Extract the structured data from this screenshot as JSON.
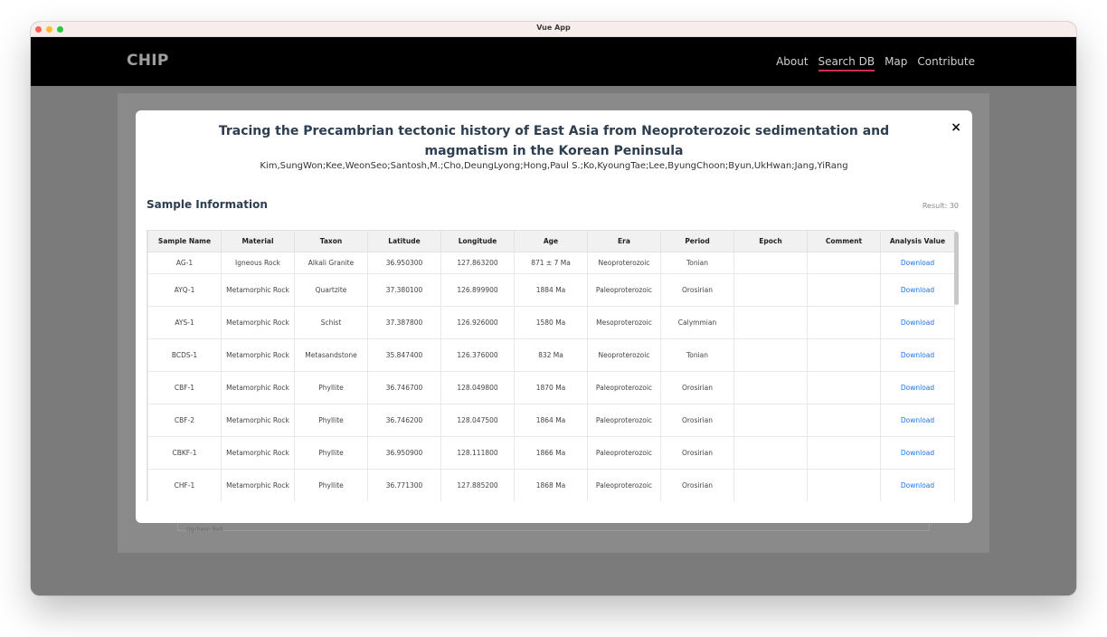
{
  "window": {
    "title": "Vue App"
  },
  "navbar": {
    "brand": "CHIP",
    "links": [
      "About",
      "Search DB",
      "Map",
      "Contribute"
    ],
    "active": "Search DB"
  },
  "background": {
    "peek_text": "Ogcheon Belt"
  },
  "modal": {
    "title": "Tracing the Precambrian tectonic history of East Asia from Neoproterozoic sedimentation and magmatism in the Korean Peninsula",
    "authors": "Kim,SungWon;Kee,WeonSeo;Santosh,M.;Cho,DeungLyong;Hong,Paul S.;Ko,KyoungTae;Lee,ByungChoon;Byun,UkHwan;Jang,YiRang",
    "close_label": "×",
    "section_title": "Sample Information",
    "result_text": "Result: 30",
    "table": {
      "headers": [
        "Sample Name",
        "Material",
        "Taxon",
        "Latitude",
        "Longitude",
        "Age",
        "Era",
        "Period",
        "Epoch",
        "Comment",
        "Analysis Value"
      ],
      "rows": [
        [
          "AG-1",
          "Igneous Rock",
          "Alkali Granite",
          "36.950300",
          "127.863200",
          "871 ± 7 Ma",
          "Neoproterozoic",
          "Tonian",
          "",
          "",
          "Download"
        ],
        [
          "AYQ-1",
          "Metamorphic Rock",
          "Quartzite",
          "37.380100",
          "126.899900",
          "1884 Ma",
          "Paleoproterozoic",
          "Orosirian",
          "",
          "",
          "Download"
        ],
        [
          "AYS-1",
          "Metamorphic Rock",
          "Schist",
          "37.387800",
          "126.926000",
          "1580 Ma",
          "Mesoproterozoic",
          "Calymmian",
          "",
          "",
          "Download"
        ],
        [
          "BCDS-1",
          "Metamorphic Rock",
          "Metasandstone",
          "35.847400",
          "126.376000",
          "832 Ma",
          "Neoproterozoic",
          "Tonian",
          "",
          "",
          "Download"
        ],
        [
          "CBF-1",
          "Metamorphic Rock",
          "Phyllite",
          "36.746700",
          "128.049800",
          "1870 Ma",
          "Paleoproterozoic",
          "Orosirian",
          "",
          "",
          "Download"
        ],
        [
          "CBF-2",
          "Metamorphic Rock",
          "Phyllite",
          "36.746200",
          "128.047500",
          "1864 Ma",
          "Paleoproterozoic",
          "Orosirian",
          "",
          "",
          "Download"
        ],
        [
          "CBKF-1",
          "Metamorphic Rock",
          "Phyllite",
          "36.950900",
          "128.111800",
          "1866 Ma",
          "Paleoproterozoic",
          "Orosirian",
          "",
          "",
          "Download"
        ],
        [
          "CHF-1",
          "Metamorphic Rock",
          "Phyllite",
          "36.771300",
          "127.885200",
          "1868 Ma",
          "Paleoproterozoic",
          "Orosirian",
          "",
          "",
          "Download"
        ]
      ]
    }
  }
}
